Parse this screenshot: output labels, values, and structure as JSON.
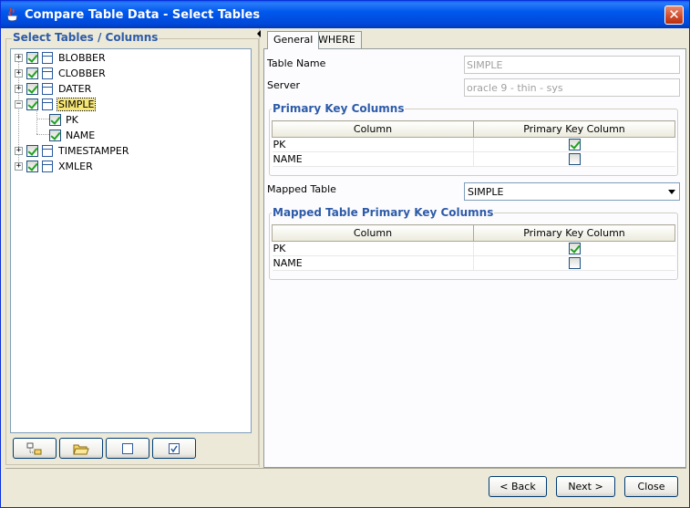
{
  "window": {
    "title": "Compare Table Data - Select Tables",
    "close_glyph": "✕"
  },
  "left": {
    "legend": "Select Tables / Columns",
    "tree": [
      {
        "label": "BLOBBER",
        "expander": "+",
        "checked": true,
        "selected": false,
        "kind": "table"
      },
      {
        "label": "CLOBBER",
        "expander": "+",
        "checked": true,
        "selected": false,
        "kind": "table"
      },
      {
        "label": "DATER",
        "expander": "+",
        "checked": true,
        "selected": false,
        "kind": "table"
      },
      {
        "label": "SIMPLE",
        "expander": "−",
        "checked": true,
        "selected": true,
        "kind": "table"
      },
      {
        "label": "PK",
        "expander": "",
        "checked": true,
        "selected": false,
        "kind": "column"
      },
      {
        "label": "NAME",
        "expander": "",
        "checked": true,
        "selected": false,
        "kind": "column"
      },
      {
        "label": "TIMESTAMPER",
        "expander": "+",
        "checked": true,
        "selected": false,
        "kind": "table"
      },
      {
        "label": "XMLER",
        "expander": "+",
        "checked": true,
        "selected": false,
        "kind": "table"
      }
    ],
    "toolbar_icons": [
      "expand-tree-icon",
      "open-folder-icon",
      "uncheck-all-icon",
      "check-all-icon"
    ]
  },
  "tabs": [
    {
      "label": "General",
      "active": true
    },
    {
      "label": "WHERE",
      "active": false
    }
  ],
  "general": {
    "table_name_label": "Table Name",
    "table_name_value": "SIMPLE",
    "server_label": "Server",
    "server_value": "oracle 9 - thin - sys",
    "pk_group_title": "Primary Key Columns",
    "pk_table": {
      "headers": [
        "Column",
        "Primary Key Column"
      ],
      "rows": [
        {
          "column": "PK",
          "pk": true
        },
        {
          "column": "NAME",
          "pk": false
        }
      ]
    },
    "mapped_table_label": "Mapped Table",
    "mapped_table_value": "SIMPLE",
    "mapped_group_title": "Mapped Table Primary Key Columns",
    "mapped_table": {
      "headers": [
        "Column",
        "Primary Key Column"
      ],
      "rows": [
        {
          "column": "PK",
          "pk": true
        },
        {
          "column": "NAME",
          "pk": false
        }
      ]
    }
  },
  "buttons": {
    "back": "< Back",
    "next": "Next >",
    "close": "Close"
  },
  "colors": {
    "title_bar": "#0054e3",
    "group_title": "#2d5ba8",
    "check_green": "#21a121",
    "selection": "#f6e676"
  }
}
